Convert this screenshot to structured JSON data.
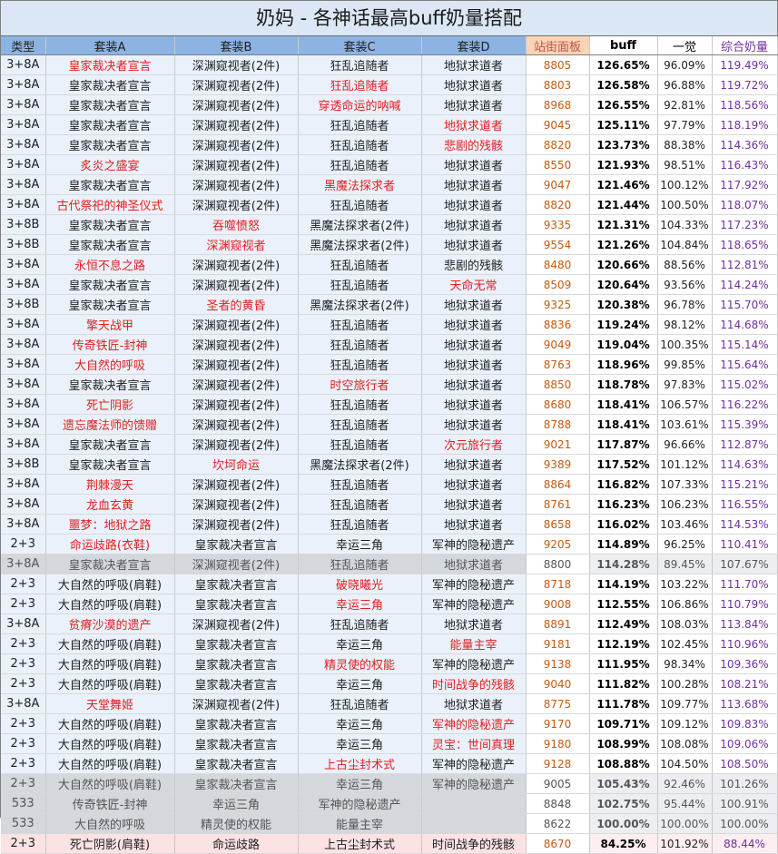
{
  "title": "奶妈 - 各神话最高buff奶量搭配",
  "headers": [
    "类型",
    "套装A",
    "套装B",
    "套装C",
    "套装D",
    "站街面板",
    "buff",
    "一觉",
    "综合奶量"
  ],
  "colors": {
    "header_blue": "#8db3e2",
    "header_panel": "#fbd4b4",
    "row_light": "#eaf1fb",
    "row_gray": "#d4d7dc",
    "row_pink": "#fde2e4",
    "highlight_red": "#e02020",
    "total_purple": "#7030a0",
    "panel_orange": "#c55a11"
  },
  "rows": [
    {
      "type": "3+8A",
      "a": "皇家裁决者宣言",
      "b": "深渊窥视者(2件)",
      "c": "狂乱追随者",
      "d": "地狱求道者",
      "panel": "8805",
      "buff": "126.65%",
      "awake": "96.09%",
      "total": "119.49%",
      "red": "a",
      "style": "light"
    },
    {
      "type": "3+8A",
      "a": "皇家裁决者宣言",
      "b": "深渊窥视者(2件)",
      "c": "狂乱追随者",
      "d": "地狱求道者",
      "panel": "8803",
      "buff": "126.58%",
      "awake": "96.88%",
      "total": "119.72%",
      "red": "c",
      "style": "light"
    },
    {
      "type": "3+8A",
      "a": "皇家裁决者宣言",
      "b": "深渊窥视者(2件)",
      "c": "穿透命运的呐喊",
      "d": "地狱求道者",
      "panel": "8968",
      "buff": "126.55%",
      "awake": "92.81%",
      "total": "118.56%",
      "red": "c",
      "style": "light"
    },
    {
      "type": "3+8A",
      "a": "皇家裁决者宣言",
      "b": "深渊窥视者(2件)",
      "c": "狂乱追随者",
      "d": "地狱求道者",
      "panel": "9045",
      "buff": "125.11%",
      "awake": "97.79%",
      "total": "118.19%",
      "red": "d",
      "style": "light"
    },
    {
      "type": "3+8A",
      "a": "皇家裁决者宣言",
      "b": "深渊窥视者(2件)",
      "c": "狂乱追随者",
      "d": "悲剧的残骸",
      "panel": "8820",
      "buff": "123.73%",
      "awake": "88.38%",
      "total": "114.36%",
      "red": "d",
      "style": "light"
    },
    {
      "type": "3+8A",
      "a": "炙炎之盛宴",
      "b": "深渊窥视者(2件)",
      "c": "狂乱追随者",
      "d": "地狱求道者",
      "panel": "8550",
      "buff": "121.93%",
      "awake": "98.51%",
      "total": "116.43%",
      "red": "a",
      "style": "light"
    },
    {
      "type": "3+8A",
      "a": "皇家裁决者宣言",
      "b": "深渊窥视者(2件)",
      "c": "黑魔法探求者",
      "d": "地狱求道者",
      "panel": "9047",
      "buff": "121.46%",
      "awake": "100.12%",
      "total": "117.92%",
      "red": "c",
      "style": "light"
    },
    {
      "type": "3+8A",
      "a": "古代祭祀的神圣仪式",
      "b": "深渊窥视者(2件)",
      "c": "狂乱追随者",
      "d": "地狱求道者",
      "panel": "8820",
      "buff": "121.44%",
      "awake": "100.50%",
      "total": "118.07%",
      "red": "a",
      "style": "light"
    },
    {
      "type": "3+8B",
      "a": "皇家裁决者宣言",
      "b": "吞噬愤怒",
      "c": "黑魔法探求者(2件)",
      "d": "地狱求道者",
      "panel": "9335",
      "buff": "121.31%",
      "awake": "104.33%",
      "total": "117.23%",
      "red": "b",
      "style": "light"
    },
    {
      "type": "3+8B",
      "a": "皇家裁决者宣言",
      "b": "深渊窥视者",
      "c": "黑魔法探求者(2件)",
      "d": "地狱求道者",
      "panel": "9554",
      "buff": "121.26%",
      "awake": "104.84%",
      "total": "118.65%",
      "red": "b",
      "style": "light"
    },
    {
      "type": "3+8A",
      "a": "永恒不息之路",
      "b": "深渊窥视者(2件)",
      "c": "狂乱追随者",
      "d": "悲剧的残骸",
      "panel": "8480",
      "buff": "120.66%",
      "awake": "88.56%",
      "total": "112.81%",
      "red": "a",
      "style": "light"
    },
    {
      "type": "3+8A",
      "a": "皇家裁决者宣言",
      "b": "深渊窥视者(2件)",
      "c": "狂乱追随者",
      "d": "天命无常",
      "panel": "8509",
      "buff": "120.64%",
      "awake": "93.56%",
      "total": "114.24%",
      "red": "d",
      "style": "light"
    },
    {
      "type": "3+8B",
      "a": "皇家裁决者宣言",
      "b": "圣者的黄昏",
      "c": "黑魔法探求者(2件)",
      "d": "地狱求道者",
      "panel": "9325",
      "buff": "120.38%",
      "awake": "96.78%",
      "total": "115.70%",
      "red": "b",
      "style": "light"
    },
    {
      "type": "3+8A",
      "a": "擎天战甲",
      "b": "深渊窥视者(2件)",
      "c": "狂乱追随者",
      "d": "地狱求道者",
      "panel": "8836",
      "buff": "119.24%",
      "awake": "98.12%",
      "total": "114.68%",
      "red": "a",
      "style": "light"
    },
    {
      "type": "3+8A",
      "a": "传奇铁匠-封神",
      "b": "深渊窥视者(2件)",
      "c": "狂乱追随者",
      "d": "地狱求道者",
      "panel": "9049",
      "buff": "119.04%",
      "awake": "100.35%",
      "total": "115.14%",
      "red": "a",
      "style": "light"
    },
    {
      "type": "3+8A",
      "a": "大自然的呼吸",
      "b": "深渊窥视者(2件)",
      "c": "狂乱追随者",
      "d": "地狱求道者",
      "panel": "8763",
      "buff": "118.96%",
      "awake": "99.85%",
      "total": "115.64%",
      "red": "a",
      "style": "light"
    },
    {
      "type": "3+8A",
      "a": "皇家裁决者宣言",
      "b": "深渊窥视者(2件)",
      "c": "时空旅行者",
      "d": "地狱求道者",
      "panel": "8850",
      "buff": "118.78%",
      "awake": "97.83%",
      "total": "115.02%",
      "red": "c",
      "style": "light"
    },
    {
      "type": "3+8A",
      "a": "死亡阴影",
      "b": "深渊窥视者(2件)",
      "c": "狂乱追随者",
      "d": "地狱求道者",
      "panel": "8680",
      "buff": "118.41%",
      "awake": "106.57%",
      "total": "116.22%",
      "red": "a",
      "style": "light"
    },
    {
      "type": "3+8A",
      "a": "遗忘魔法师的馈赠",
      "b": "深渊窥视者(2件)",
      "c": "狂乱追随者",
      "d": "地狱求道者",
      "panel": "8788",
      "buff": "118.41%",
      "awake": "103.61%",
      "total": "115.39%",
      "red": "a",
      "style": "light"
    },
    {
      "type": "3+8A",
      "a": "皇家裁决者宣言",
      "b": "深渊窥视者(2件)",
      "c": "狂乱追随者",
      "d": "次元旅行者",
      "panel": "9021",
      "buff": "117.87%",
      "awake": "96.66%",
      "total": "112.87%",
      "red": "d",
      "style": "light"
    },
    {
      "type": "3+8B",
      "a": "皇家裁决者宣言",
      "b": "坎坷命运",
      "c": "黑魔法探求者(2件)",
      "d": "地狱求道者",
      "panel": "9389",
      "buff": "117.52%",
      "awake": "101.12%",
      "total": "114.63%",
      "red": "b",
      "style": "light"
    },
    {
      "type": "3+8A",
      "a": "荆棘漫天",
      "b": "深渊窥视者(2件)",
      "c": "狂乱追随者",
      "d": "地狱求道者",
      "panel": "8864",
      "buff": "116.82%",
      "awake": "107.33%",
      "total": "115.21%",
      "red": "a",
      "style": "light"
    },
    {
      "type": "3+8A",
      "a": "龙血玄黄",
      "b": "深渊窥视者(2件)",
      "c": "狂乱追随者",
      "d": "地狱求道者",
      "panel": "8761",
      "buff": "116.23%",
      "awake": "106.23%",
      "total": "116.55%",
      "red": "a",
      "style": "light"
    },
    {
      "type": "3+8A",
      "a": "噩梦：地狱之路",
      "b": "深渊窥视者(2件)",
      "c": "狂乱追随者",
      "d": "地狱求道者",
      "panel": "8658",
      "buff": "116.02%",
      "awake": "103.46%",
      "total": "114.53%",
      "red": "a",
      "style": "light"
    },
    {
      "type": "2+3",
      "a": "命运歧路(衣鞋)",
      "b": "皇家裁决者宣言",
      "c": "幸运三角",
      "d": "军神的隐秘遗产",
      "panel": "9205",
      "buff": "114.89%",
      "awake": "96.25%",
      "total": "110.41%",
      "red": "a",
      "style": "light"
    },
    {
      "type": "3+8A",
      "a": "皇家裁决者宣言",
      "b": "深渊窥视者(2件)",
      "c": "狂乱追随者",
      "d": "地狱求道者",
      "panel": "8800",
      "buff": "114.28%",
      "awake": "89.45%",
      "total": "107.67%",
      "red": "",
      "style": "gray"
    },
    {
      "type": "2+3",
      "a": "大自然的呼吸(肩鞋)",
      "b": "皇家裁决者宣言",
      "c": "破晓曦光",
      "d": "军神的隐秘遗产",
      "panel": "8718",
      "buff": "114.19%",
      "awake": "103.22%",
      "total": "111.70%",
      "red": "c",
      "style": "light"
    },
    {
      "type": "2+3",
      "a": "大自然的呼吸(肩鞋)",
      "b": "皇家裁决者宣言",
      "c": "幸运三角",
      "d": "军神的隐秘遗产",
      "panel": "9008",
      "buff": "112.55%",
      "awake": "106.86%",
      "total": "110.79%",
      "red": "c",
      "style": "light"
    },
    {
      "type": "3+8A",
      "a": "贫瘠沙漠的遗产",
      "b": "深渊窥视者(2件)",
      "c": "狂乱追随者",
      "d": "地狱求道者",
      "panel": "8891",
      "buff": "112.49%",
      "awake": "108.03%",
      "total": "113.84%",
      "red": "a",
      "style": "light"
    },
    {
      "type": "2+3",
      "a": "大自然的呼吸(肩鞋)",
      "b": "皇家裁决者宣言",
      "c": "幸运三角",
      "d": "能量主宰",
      "panel": "9181",
      "buff": "112.19%",
      "awake": "102.45%",
      "total": "110.96%",
      "red": "d",
      "style": "light"
    },
    {
      "type": "2+3",
      "a": "大自然的呼吸(肩鞋)",
      "b": "皇家裁决者宣言",
      "c": "精灵使的权能",
      "d": "军神的隐秘遗产",
      "panel": "9138",
      "buff": "111.95%",
      "awake": "98.34%",
      "total": "109.36%",
      "red": "c",
      "style": "light"
    },
    {
      "type": "2+3",
      "a": "大自然的呼吸(肩鞋)",
      "b": "皇家裁决者宣言",
      "c": "幸运三角",
      "d": "时间战争的残骸",
      "panel": "9040",
      "buff": "111.82%",
      "awake": "100.28%",
      "total": "108.21%",
      "red": "d",
      "style": "light"
    },
    {
      "type": "3+8A",
      "a": "天堂舞姬",
      "b": "深渊窥视者(2件)",
      "c": "狂乱追随者",
      "d": "地狱求道者",
      "panel": "8775",
      "buff": "111.78%",
      "awake": "109.77%",
      "total": "113.68%",
      "red": "a",
      "style": "light"
    },
    {
      "type": "2+3",
      "a": "大自然的呼吸(肩鞋)",
      "b": "皇家裁决者宣言",
      "c": "幸运三角",
      "d": "军神的隐秘遗产",
      "panel": "9170",
      "buff": "109.71%",
      "awake": "109.12%",
      "total": "109.83%",
      "red": "d",
      "style": "light"
    },
    {
      "type": "2+3",
      "a": "大自然的呼吸(肩鞋)",
      "b": "皇家裁决者宣言",
      "c": "幸运三角",
      "d": "灵宝：世间真理",
      "panel": "9180",
      "buff": "108.99%",
      "awake": "108.08%",
      "total": "109.06%",
      "red": "d",
      "style": "light"
    },
    {
      "type": "2+3",
      "a": "大自然的呼吸(肩鞋)",
      "b": "皇家裁决者宣言",
      "c": "上古尘封术式",
      "d": "军神的隐秘遗产",
      "panel": "9128",
      "buff": "108.88%",
      "awake": "104.50%",
      "total": "108.50%",
      "red": "c",
      "style": "light"
    },
    {
      "type": "2+3",
      "a": "大自然的呼吸(肩鞋)",
      "b": "皇家裁决者宣言",
      "c": "幸运三角",
      "d": "军神的隐秘遗产",
      "panel": "9005",
      "buff": "105.43%",
      "awake": "92.46%",
      "total": "101.26%",
      "red": "",
      "style": "gray"
    },
    {
      "type": "533",
      "a": "传奇铁匠-封神",
      "b": "幸运三角",
      "c": "军神的隐秘遗产",
      "d": "",
      "panel": "8848",
      "buff": "102.75%",
      "awake": "95.44%",
      "total": "100.91%",
      "red": "",
      "style": "gray"
    },
    {
      "type": "533",
      "a": "大自然的呼吸",
      "b": "精灵使的权能",
      "c": "能量主宰",
      "d": "",
      "panel": "8622",
      "buff": "100.00%",
      "awake": "100.00%",
      "total": "100.00%",
      "red": "",
      "style": "gray"
    },
    {
      "type": "2+3",
      "a": "死亡阴影(肩鞋)",
      "b": "命运歧路",
      "c": "上古尘封术式",
      "d": "时间战争的残骸",
      "panel": "8670",
      "buff": "84.25%",
      "awake": "101.92%",
      "total": "88.44%",
      "red": "",
      "style": "pink"
    }
  ]
}
